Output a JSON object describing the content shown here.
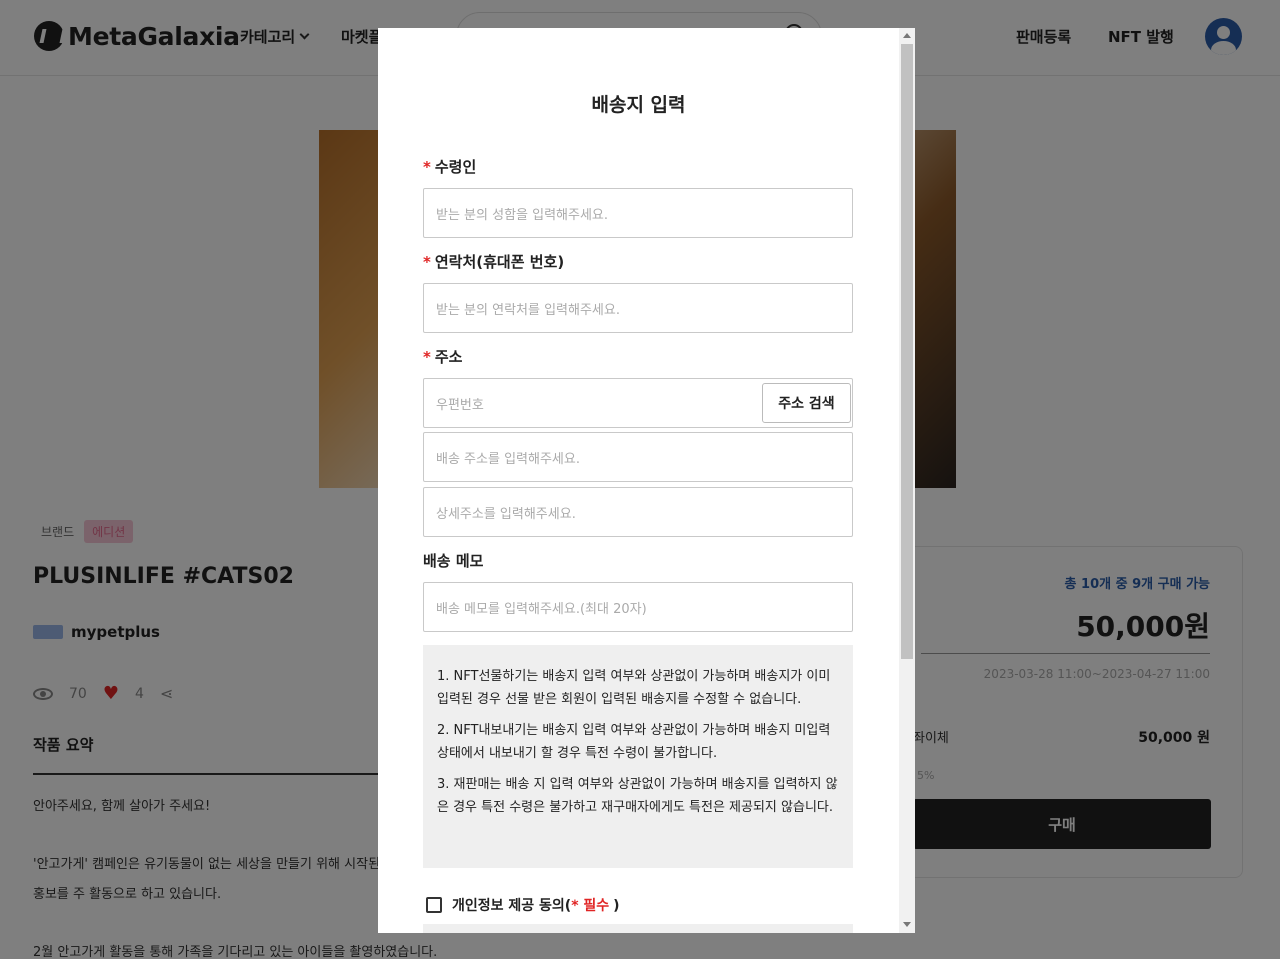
{
  "header": {
    "logo": "MetaGalaxia",
    "nav_category": "카테고리",
    "nav_market": "마켓플",
    "nav_register": "판매등록",
    "nav_issue": "NFT 발행"
  },
  "background": {
    "brand_label": "브랜드",
    "edition_badge": "에디션",
    "item_title": "PLUSINLIFE #CATS02",
    "creator_name": "mypetplus",
    "views": "70",
    "likes": "4",
    "summary_title": "작품 요약",
    "desc_1": "안아주세요, 함께 살아가 주세요!",
    "desc_2": "'안고가게' 캠페인은 유기동물이 없는 세상을 만들기 위해 시작된 캠",
    "desc_3": "홍보를 주 활동으로 하고 있습니다.",
    "desc_4": "2월 안고가게 활동을 통해 가족을 기다리고 있는 아이들을 촬영하였습니다."
  },
  "price_card": {
    "availability": "총 10개 중 9개 구매 가능",
    "price": "50,000원",
    "period": "2023-03-28 11:00~2023-04-27 11:00",
    "pay_label": "좌이체",
    "pay_value": "50,000 원",
    "fee": "5%",
    "buy_label": "구매"
  },
  "modal": {
    "title": "배송지 입력",
    "recipient_label": "수령인",
    "recipient_placeholder": "받는 분의 성함을 입력해주세요.",
    "phone_label": "연락처(휴대폰 번호)",
    "phone_placeholder": "받는 분의 연락처를 입력해주세요.",
    "address_label": "주소",
    "zip_placeholder": "우편번호",
    "address_search_button": "주소 검색",
    "address_placeholder": "배송 주소를 입력해주세요.",
    "address_detail_placeholder": "상세주소를 입력해주세요.",
    "memo_label": "배송 메모",
    "memo_placeholder": "배송 메모를 입력해주세요.(최대 20자)",
    "required_mark": "*",
    "notice": [
      "1. NFT선물하기는 배송지 입력 여부와 상관없이 가능하며 배송지가 이미 입력된 경우 선물 받은 회원이 입력된 배송지를 수정할 수 없습니다.",
      "2. NFT내보내기는 배송지 입력 여부와 상관없이 가능하며 배송지 미입력 상태에서 내보내기 할 경우 특전 수령이 불가합니다.",
      "3. 재판매는 배송 지 입력 여부와 상관없이 가능하며 배송지를 입력하지 않은 경우 특전 수령은 불가하고 재구매자에게도 특전은 제공되지 않습니다."
    ],
    "consent_label": "개인정보 제공 동의(",
    "consent_required": "* 필수",
    "consent_close": ")"
  }
}
